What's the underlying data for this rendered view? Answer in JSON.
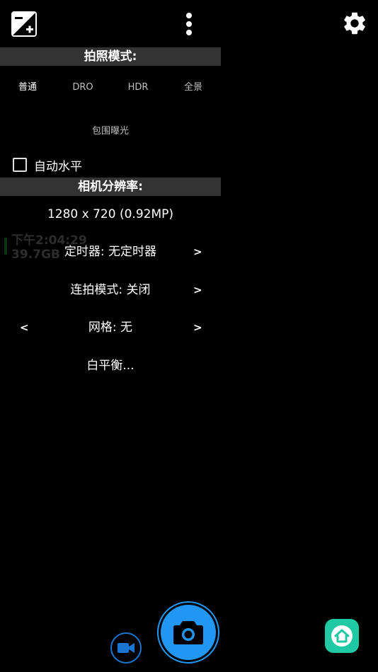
{
  "topbar": {
    "exposure_icon": "exposure-plus-minus-icon",
    "menu_icon": "more-vertical-icon",
    "settings_icon": "gear-icon"
  },
  "panel": {
    "photo_mode_header": "拍照模式:",
    "modes": [
      {
        "label": "普通",
        "selected": true
      },
      {
        "label": "DRO",
        "selected": false
      },
      {
        "label": "HDR",
        "selected": false
      },
      {
        "label": "全景",
        "selected": false
      }
    ],
    "bracket_label": "包围曝光",
    "auto_level_label": "自动水平",
    "resolution_header": "相机分辨率:",
    "resolution_value": "1280 x 720 (0.92MP)",
    "timer_label": "定时器: 无定时器",
    "burst_label": "连拍模式: 关闭",
    "grid_label": "网格: 无",
    "white_balance_label": "白平衡...",
    "arrow_right": ">",
    "arrow_left": "<"
  },
  "background": {
    "time": "下午2:04:29",
    "storage": "39.7GB"
  },
  "colors": {
    "accent": "#2196f3",
    "header_bg": "#333333",
    "home_button": "#1ec9a3"
  }
}
